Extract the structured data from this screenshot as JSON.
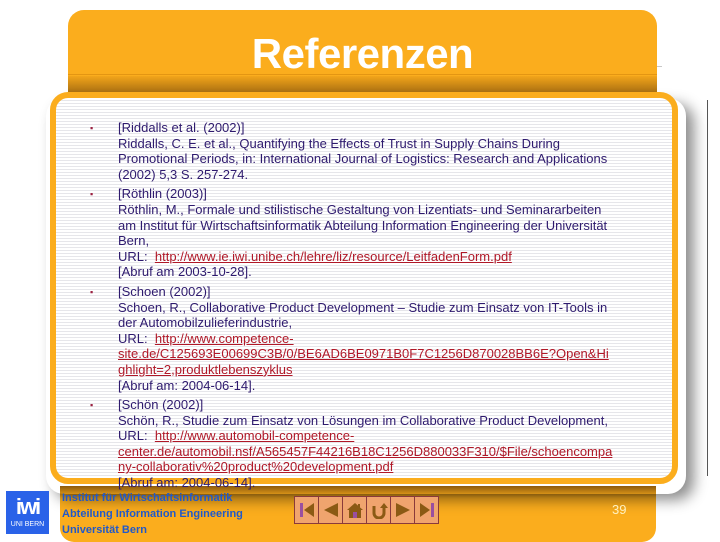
{
  "slide": {
    "title": "Referenzen",
    "page_number": "39",
    "colors": {
      "accent": "#fbad1d",
      "text": "#2e1a6e",
      "link": "#b01828",
      "institute": "#2159c9",
      "logo_bg": "#2a62e8"
    }
  },
  "references": [
    {
      "key": "[Riddalls et al. (2002)]",
      "lines": [
        "Riddalls, C. E. et al., Quantifying the Effects of Trust in Supply Chains During",
        "Promotional Periods, in: International Journal of Logistics: Research and Applications",
        "(2002) 5,3 S. 257-274."
      ]
    },
    {
      "key": "[Röthlin (2003)]",
      "lines": [
        "Röthlin, M., Formale und stilistische Gestaltung von Lizentiats- und Seminararbeiten",
        "am Institut für Wirtschaftsinformatik Abteilung Information Engineering der Universität",
        "Bern,"
      ],
      "url_label": "URL:",
      "url_lines": [
        "http://www.ie.iwi.unibe.ch/lehre/liz/resource/LeitfadenForm.pdf"
      ],
      "accessed": "[Abruf am 2003-10-28]."
    },
    {
      "key": "[Schoen (2002)]",
      "lines": [
        "Schoen, R., Collaborative Product Development – Studie zum Einsatz von IT-Tools in",
        "der Automobilzulieferindustrie,"
      ],
      "url_label": "URL:",
      "url_lines": [
        "http://www.competence-",
        "site.de/C125693E00699C3B/0/BE6AD6BE0971B0F7C1256D870028BB6E?Open&Hi",
        "ghlight=2,produktlebenszyklus"
      ],
      "accessed": "[Abruf am: 2004-06-14]."
    },
    {
      "key": "[Schön (2002)]",
      "lines": [
        "Schön, R., Studie zum Einsatz von Lösungen im Collaborative Product Development,"
      ],
      "url_label": "URL:",
      "url_lines": [
        "http://www.automobil-competence-",
        "center.de/automobil.nsf/A565457F44216B18C1256D880033F310/$File/schoencompa",
        "ny-collaborativ%20product%20development.pdf"
      ],
      "accessed": "[Abruf am: 2004-06-14]."
    }
  ],
  "footer": {
    "institute_lines": [
      "Institut für Wirtschaftsinformatik",
      "Abteilung Information Engineering",
      "Universität Bern"
    ],
    "logo": {
      "big": "iwi",
      "small": "UNI BERN"
    },
    "nav_buttons": [
      {
        "name": "first-slide",
        "icon": "skip-first-icon"
      },
      {
        "name": "previous-slide",
        "icon": "previous-icon"
      },
      {
        "name": "home",
        "icon": "home-icon"
      },
      {
        "name": "return",
        "icon": "return-icon"
      },
      {
        "name": "next-slide",
        "icon": "next-icon"
      },
      {
        "name": "last-slide",
        "icon": "skip-last-icon"
      }
    ]
  }
}
